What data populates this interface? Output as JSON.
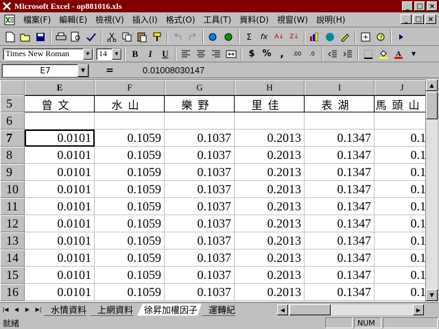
{
  "window": {
    "title": "Microsoft Excel - op881016.xls",
    "buttons": {
      "minimize": "_",
      "maximize": "□",
      "close": "×"
    }
  },
  "menu": {
    "items": [
      "檔案(F)",
      "編輯(E)",
      "檢視(V)",
      "插入(I)",
      "格式(O)",
      "工具(T)",
      "資料(D)",
      "視窗(W)",
      "說明(H)"
    ]
  },
  "formatting": {
    "font_name": "Times New Roman",
    "font_size": "14",
    "bold": "B",
    "italic": "I",
    "underline": "U",
    "currency": "$",
    "percent": "%",
    "comma": ",",
    "inc_decimal": ".00",
    "dec_decimal": ".0"
  },
  "toolbar_std": {
    "sum": "Σ",
    "fx": "fx",
    "sort_asc": "A↓",
    "sort_desc": "Z↓"
  },
  "formula_bar": {
    "name_box": "E7",
    "equals": "=",
    "value": "0.01008030147"
  },
  "grid": {
    "columns": [
      "E",
      "F",
      "G",
      "H",
      "I",
      "J"
    ],
    "active_column": "E",
    "rows": [
      {
        "num": "5",
        "cells": [
          "曾文",
          "水山",
          "樂野",
          "里佳",
          "表湖",
          "馬頭山"
        ],
        "header": true
      },
      {
        "num": "6",
        "cells": [
          "",
          "",
          "",
          "",
          "",
          ""
        ]
      },
      {
        "num": "7",
        "cells": [
          "0.0101",
          "0.1059",
          "0.1037",
          "0.2013",
          "0.1347",
          "0.1"
        ],
        "active": true
      },
      {
        "num": "8",
        "cells": [
          "0.0101",
          "0.1059",
          "0.1037",
          "0.2013",
          "0.1347",
          "0.1"
        ]
      },
      {
        "num": "9",
        "cells": [
          "0.0101",
          "0.1059",
          "0.1037",
          "0.2013",
          "0.1347",
          "0.1"
        ]
      },
      {
        "num": "10",
        "cells": [
          "0.0101",
          "0.1059",
          "0.1037",
          "0.2013",
          "0.1347",
          "0.1"
        ]
      },
      {
        "num": "11",
        "cells": [
          "0.0101",
          "0.1059",
          "0.1037",
          "0.2013",
          "0.1347",
          "0.1"
        ]
      },
      {
        "num": "12",
        "cells": [
          "0.0101",
          "0.1059",
          "0.1037",
          "0.2013",
          "0.1347",
          "0.1"
        ]
      },
      {
        "num": "13",
        "cells": [
          "0.0101",
          "0.1059",
          "0.1037",
          "0.2013",
          "0.1347",
          "0.1"
        ]
      },
      {
        "num": "14",
        "cells": [
          "0.0101",
          "0.1059",
          "0.1037",
          "0.2013",
          "0.1347",
          "0.1"
        ]
      },
      {
        "num": "15",
        "cells": [
          "0.0101",
          "0.1059",
          "0.1037",
          "0.2013",
          "0.1347",
          "0.1"
        ]
      },
      {
        "num": "16",
        "cells": [
          "0.0101",
          "0.1059",
          "0.1037",
          "0.2013",
          "0.1347",
          "0.1"
        ]
      }
    ]
  },
  "sheets": {
    "tabs": [
      "水情資料",
      "上網資料",
      "徐昇加權因子",
      "運轉紀"
    ],
    "active": "徐昇加權因子"
  },
  "status": {
    "text": "就緒",
    "num": "NUM"
  },
  "colors": {
    "title_bar": "#800000",
    "chrome": "#c0c0c0"
  }
}
